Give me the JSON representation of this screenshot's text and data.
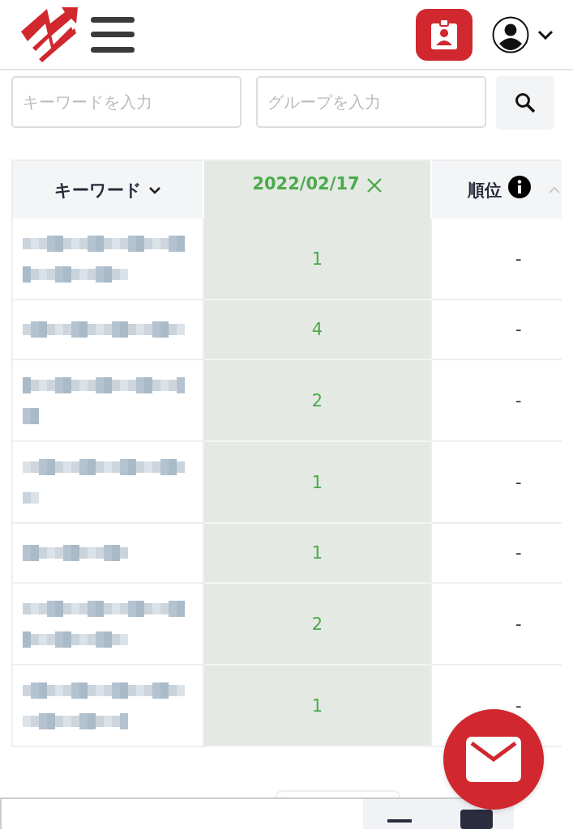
{
  "search": {
    "keyword_placeholder": "キーワードを入力",
    "group_placeholder": "グループを入力"
  },
  "table": {
    "columns": [
      {
        "label": "キーワード",
        "kind": "dropdown"
      },
      {
        "label": "2022/02/17",
        "kind": "date"
      },
      {
        "label": "順位",
        "kind": "info"
      }
    ],
    "rows": [
      {
        "kind": "blurred-two-line",
        "date_value": "1",
        "rank": "-"
      },
      {
        "kind": "blurred-one-line",
        "date_value": "4",
        "rank": "-"
      },
      {
        "kind": "blurred-line-and-stub",
        "date_value": "2",
        "rank": "-"
      },
      {
        "kind": "blurred-line-and-stub",
        "date_value": "1",
        "rank": "-"
      },
      {
        "kind": "blurred-short-line",
        "date_value": "1",
        "rank": "-"
      },
      {
        "kind": "blurred-two-line",
        "date_value": "2",
        "rank": "-"
      },
      {
        "kind": "blurred-two-line",
        "date_value": "1",
        "rank": "-"
      }
    ]
  }
}
